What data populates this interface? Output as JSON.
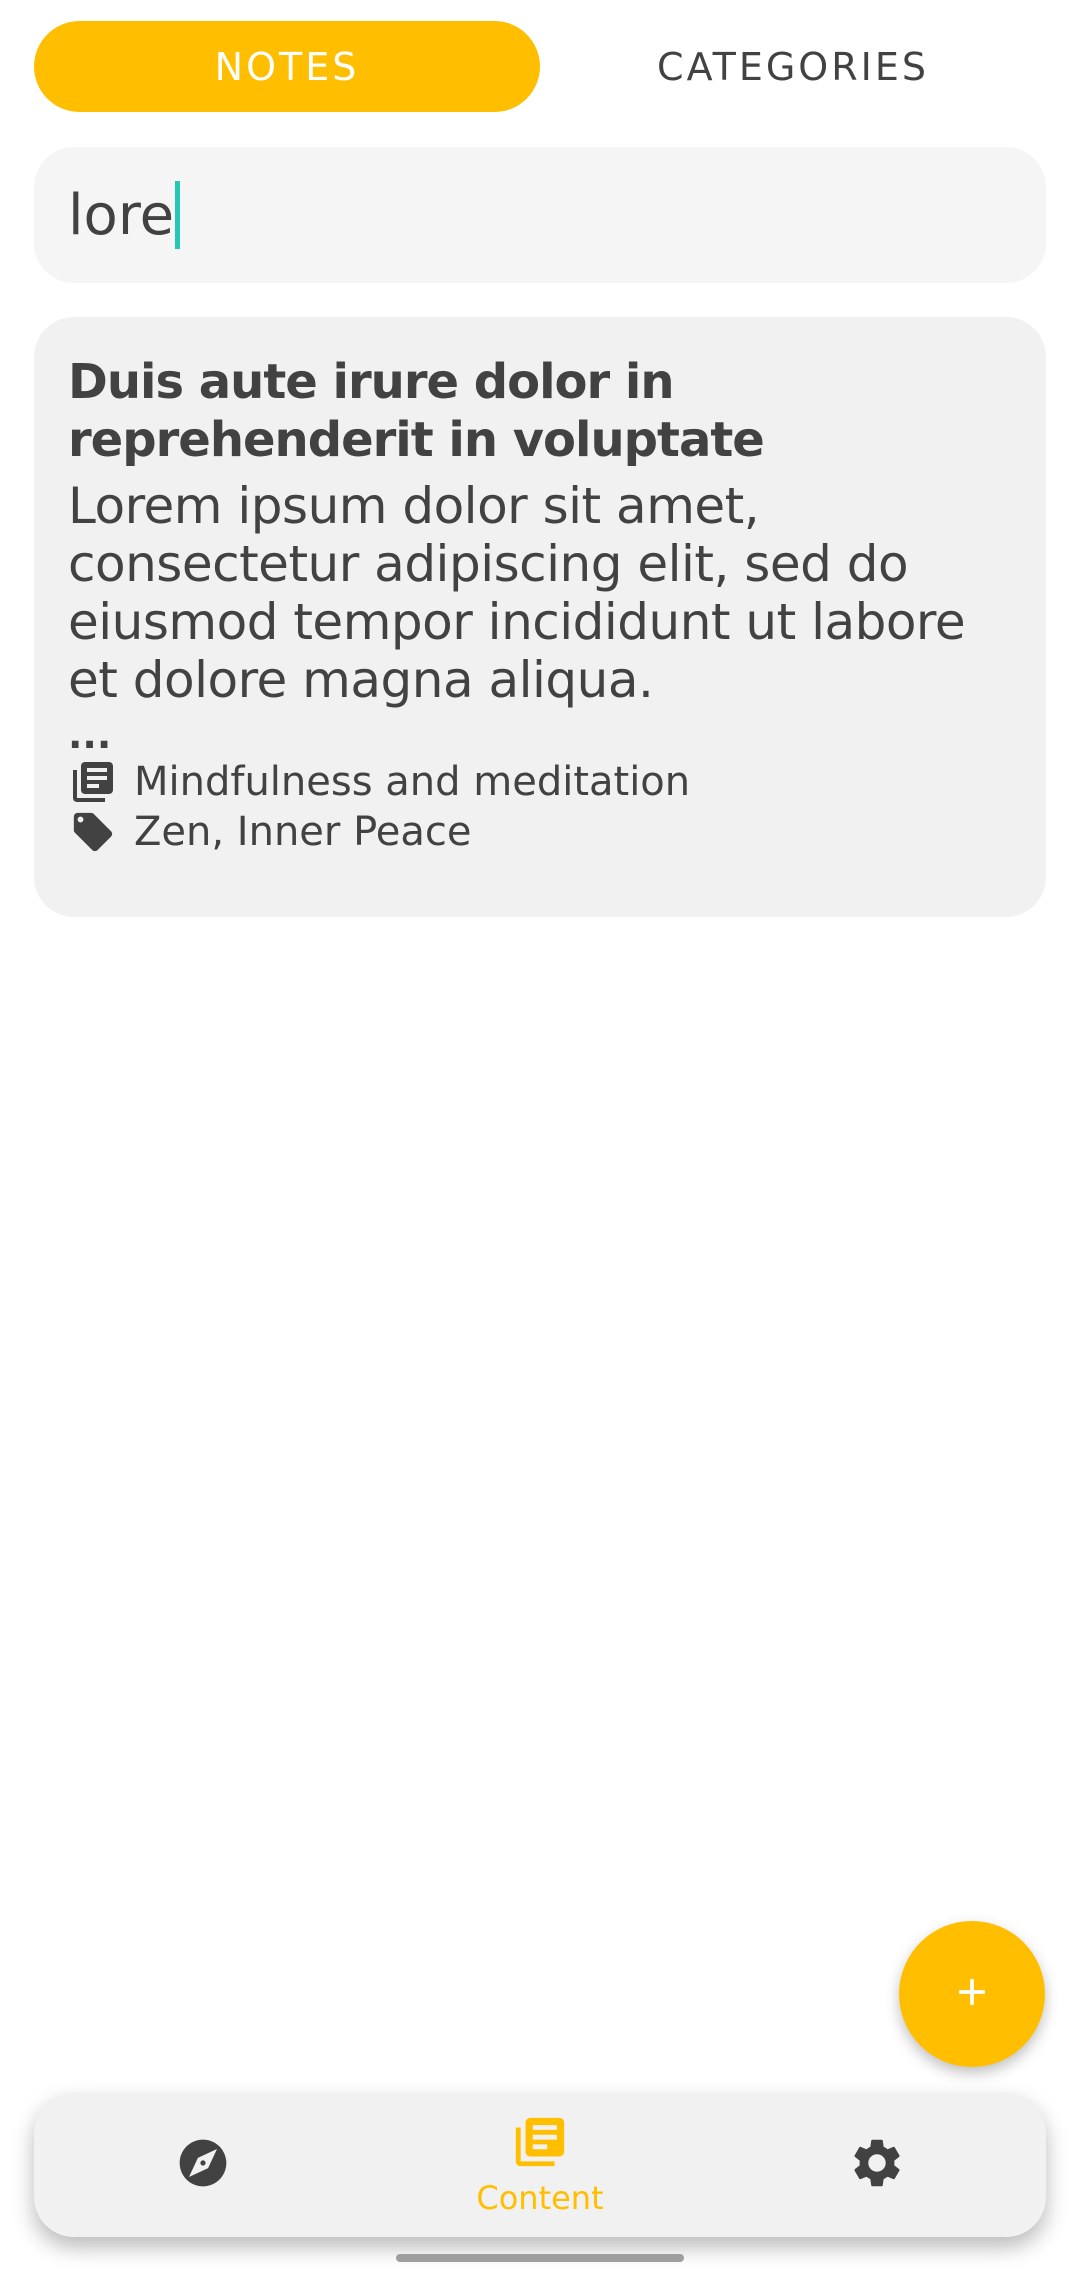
{
  "tabs": {
    "notes_label": "NOTES",
    "categories_label": "CATEGORIES",
    "active": "notes"
  },
  "search": {
    "value": "lore",
    "caret_color": "#26c6b5"
  },
  "notes": [
    {
      "title": "Duis aute irure dolor in reprehenderit in voluptate",
      "body": "Lorem ipsum dolor sit amet, consectetur adipiscing elit, sed do eiusmod tempor incididunt ut labore et dolore magna aliqua.",
      "ellipsis": "...",
      "category": "Mindfulness and meditation",
      "category_icon": "library-books-icon",
      "tags": "Zen, Inner Peace",
      "tags_icon": "tag-icon"
    }
  ],
  "fab": {
    "icon": "plus-icon"
  },
  "bottom_nav": {
    "items": [
      {
        "icon": "compass-icon",
        "label": ""
      },
      {
        "icon": "library-books-icon",
        "label": "Content",
        "active": true
      },
      {
        "icon": "gear-icon",
        "label": ""
      }
    ]
  },
  "colors": {
    "accent": "#ffbf00",
    "text": "#424242",
    "card_bg": "#f1f1f1",
    "search_bg": "#f5f5f5"
  }
}
